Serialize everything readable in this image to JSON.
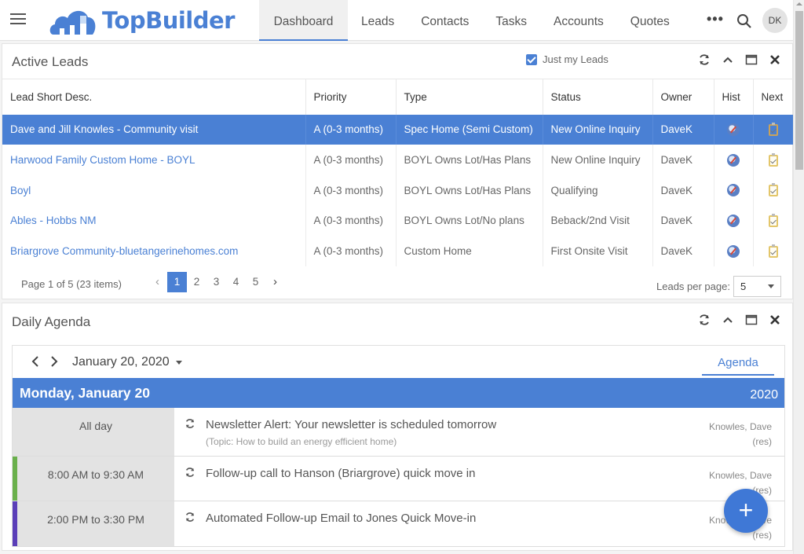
{
  "app": {
    "brand": "TopBuilder",
    "brand_color": "#4a80d4",
    "nav_tabs": [
      {
        "label": "Dashboard",
        "active": true
      },
      {
        "label": "Leads"
      },
      {
        "label": "Contacts"
      },
      {
        "label": "Tasks"
      },
      {
        "label": "Accounts"
      },
      {
        "label": "Quotes"
      }
    ],
    "more_label": "•••",
    "avatar_initials": "DK"
  },
  "leads": {
    "title": "Active Leads",
    "just_my_leads_label": "Just my Leads",
    "just_my_leads_checked": true,
    "columns": [
      "Lead Short Desc.",
      "Priority",
      "Type",
      "Status",
      "Owner",
      "Hist",
      "Next"
    ],
    "rows": [
      {
        "desc": "Dave and Jill Knowles - Community visit",
        "priority": "A (0-3 months)",
        "type": "Spec Home (Semi Custom)",
        "status": "New Online Inquiry",
        "owner": "DaveK",
        "selected": true
      },
      {
        "desc": "Harwood Family Custom Home - BOYL",
        "priority": "A (0-3 months)",
        "type": "BOYL Owns Lot/Has Plans",
        "status": "New Online Inquiry",
        "owner": "DaveK"
      },
      {
        "desc": "Boyl",
        "priority": "A (0-3 months)",
        "type": "BOYL Owns Lot/Has Plans",
        "status": "Qualifying",
        "owner": "DaveK"
      },
      {
        "desc": "Ables - Hobbs NM",
        "priority": "A (0-3 months)",
        "type": "BOYL Owns Lot/No plans",
        "status": "Beback/2nd Visit",
        "owner": "DaveK"
      },
      {
        "desc": "Briargrove Community-bluetangerinehomes.com",
        "priority": "A (0-3 months)",
        "type": "Custom Home",
        "status": "First Onsite Visit",
        "owner": "DaveK"
      }
    ],
    "pager": {
      "info": "Page 1 of 5 (23 items)",
      "pages": [
        "1",
        "2",
        "3",
        "4",
        "5"
      ],
      "current_page": "1",
      "per_page_label": "Leads per page:",
      "per_page_value": "5"
    }
  },
  "agenda": {
    "title": "Daily Agenda",
    "date_label": "January 20, 2020",
    "view_tab": "Agenda",
    "day_name": "Monday, January 20",
    "year": "2020",
    "events": [
      {
        "time": "All day",
        "title": "Newsletter Alert: Your newsletter is scheduled tomorrow",
        "subtitle": "(Topic: How to build an energy efficient home)",
        "owner": "Knowles, Dave",
        "owner_note": "(res)",
        "color": ""
      },
      {
        "time": "8:00 AM to 9:30 AM",
        "title": "Follow-up call to Hanson (Briargrove) quick move in",
        "subtitle": "",
        "owner": "Knowles, Dave",
        "owner_note": "(res)",
        "color": "#6ab04c"
      },
      {
        "time": "2:00 PM to 3:30 PM",
        "title": "Automated Follow-up Email to Jones Quick Move-in",
        "subtitle": "",
        "owner": "Knowles, Dave",
        "owner_note": "(res)",
        "color": "#5b3fb8"
      }
    ]
  },
  "fab_label": "+"
}
